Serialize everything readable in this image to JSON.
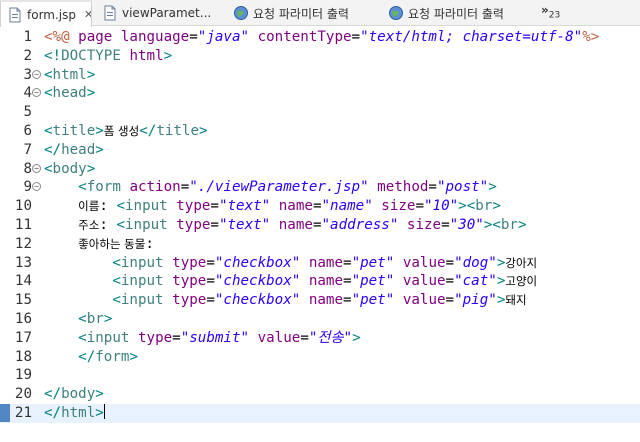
{
  "tabs": [
    {
      "label": "form.jsp",
      "icon": "jsp-file-icon",
      "active": true,
      "close": "✕"
    },
    {
      "label": "viewParamet...",
      "icon": "jsp-file-icon",
      "active": false
    },
    {
      "label": "요청 파라미터 출력",
      "icon": "globe-icon",
      "active": false
    },
    {
      "label": "요청 파라미터 출력",
      "icon": "globe-icon",
      "active": false
    }
  ],
  "overflow": {
    "label": "»",
    "count": "23"
  },
  "editor": {
    "current_line": 21,
    "lines": [
      {
        "n": "1",
        "tokens": [
          [
            "dir",
            "<%@"
          ],
          [
            "text",
            " "
          ],
          [
            "attr",
            "page"
          ],
          [
            "text",
            " "
          ],
          [
            "attr",
            "language"
          ],
          [
            "text",
            "="
          ],
          [
            "val",
            "\"java\""
          ],
          [
            "text",
            " "
          ],
          [
            "attr",
            "contentType"
          ],
          [
            "text",
            "="
          ],
          [
            "val",
            "\"text/html; charset=utf-8\""
          ],
          [
            "dir",
            "%>"
          ]
        ]
      },
      {
        "n": "2",
        "tokens": [
          [
            "delim",
            "<!"
          ],
          [
            "tag",
            "DOCTYPE"
          ],
          [
            "text",
            " "
          ],
          [
            "attr",
            "html"
          ],
          [
            "delim",
            ">"
          ]
        ]
      },
      {
        "n": "3",
        "fold": true,
        "tokens": [
          [
            "delim",
            "<"
          ],
          [
            "tag",
            "html"
          ],
          [
            "delim",
            ">"
          ]
        ]
      },
      {
        "n": "4",
        "fold": true,
        "tokens": [
          [
            "delim",
            "<"
          ],
          [
            "tag",
            "head"
          ],
          [
            "delim",
            ">"
          ]
        ]
      },
      {
        "n": "5",
        "tokens": []
      },
      {
        "n": "6",
        "tokens": [
          [
            "delim",
            "<"
          ],
          [
            "tag",
            "title"
          ],
          [
            "delim",
            ">"
          ],
          [
            "ko",
            "폼 생성"
          ],
          [
            "delim",
            "</"
          ],
          [
            "tag",
            "title"
          ],
          [
            "delim",
            ">"
          ]
        ]
      },
      {
        "n": "7",
        "tokens": [
          [
            "delim",
            "</"
          ],
          [
            "tag",
            "head"
          ],
          [
            "delim",
            ">"
          ]
        ]
      },
      {
        "n": "8",
        "fold": true,
        "tokens": [
          [
            "delim",
            "<"
          ],
          [
            "tag",
            "body"
          ],
          [
            "delim",
            ">"
          ]
        ]
      },
      {
        "n": "9",
        "fold": true,
        "tokens": [
          [
            "text",
            "    "
          ],
          [
            "delim",
            "<"
          ],
          [
            "tag",
            "form"
          ],
          [
            "text",
            " "
          ],
          [
            "attr",
            "action"
          ],
          [
            "text",
            "="
          ],
          [
            "val",
            "\"./viewParameter.jsp\""
          ],
          [
            "text",
            " "
          ],
          [
            "attr",
            "method"
          ],
          [
            "text",
            "="
          ],
          [
            "val",
            "\"post\""
          ],
          [
            "delim",
            ">"
          ]
        ]
      },
      {
        "n": "10",
        "tokens": [
          [
            "text",
            "    "
          ],
          [
            "ko",
            "이름"
          ],
          [
            "text",
            ": "
          ],
          [
            "delim",
            "<"
          ],
          [
            "tag",
            "input"
          ],
          [
            "text",
            " "
          ],
          [
            "attr",
            "type"
          ],
          [
            "text",
            "="
          ],
          [
            "val",
            "\"text\""
          ],
          [
            "text",
            " "
          ],
          [
            "attr",
            "name"
          ],
          [
            "text",
            "="
          ],
          [
            "val",
            "\"name\""
          ],
          [
            "text",
            " "
          ],
          [
            "attr",
            "size"
          ],
          [
            "text",
            "="
          ],
          [
            "val",
            "\"10\""
          ],
          [
            "delim",
            ">"
          ],
          [
            "delim",
            "<"
          ],
          [
            "tag",
            "br"
          ],
          [
            "delim",
            ">"
          ]
        ]
      },
      {
        "n": "11",
        "tokens": [
          [
            "text",
            "    "
          ],
          [
            "ko",
            "주소"
          ],
          [
            "text",
            ": "
          ],
          [
            "delim",
            "<"
          ],
          [
            "tag",
            "input"
          ],
          [
            "text",
            " "
          ],
          [
            "attr",
            "type"
          ],
          [
            "text",
            "="
          ],
          [
            "val",
            "\"text\""
          ],
          [
            "text",
            " "
          ],
          [
            "attr",
            "name"
          ],
          [
            "text",
            "="
          ],
          [
            "val",
            "\"address\""
          ],
          [
            "text",
            " "
          ],
          [
            "attr",
            "size"
          ],
          [
            "text",
            "="
          ],
          [
            "val",
            "\"30\""
          ],
          [
            "delim",
            ">"
          ],
          [
            "delim",
            "<"
          ],
          [
            "tag",
            "br"
          ],
          [
            "delim",
            ">"
          ]
        ]
      },
      {
        "n": "12",
        "tokens": [
          [
            "text",
            "    "
          ],
          [
            "ko",
            "좋아하는 동물"
          ],
          [
            "text",
            ":"
          ]
        ]
      },
      {
        "n": "13",
        "tokens": [
          [
            "text",
            "        "
          ],
          [
            "delim",
            "<"
          ],
          [
            "tag",
            "input"
          ],
          [
            "text",
            " "
          ],
          [
            "attr",
            "type"
          ],
          [
            "text",
            "="
          ],
          [
            "val",
            "\"checkbox\""
          ],
          [
            "text",
            " "
          ],
          [
            "attr",
            "name"
          ],
          [
            "text",
            "="
          ],
          [
            "val",
            "\"pet\""
          ],
          [
            "text",
            " "
          ],
          [
            "attr",
            "value"
          ],
          [
            "text",
            "="
          ],
          [
            "val",
            "\"dog\""
          ],
          [
            "delim",
            ">"
          ],
          [
            "ko",
            "강아지"
          ]
        ]
      },
      {
        "n": "14",
        "tokens": [
          [
            "text",
            "        "
          ],
          [
            "delim",
            "<"
          ],
          [
            "tag",
            "input"
          ],
          [
            "text",
            " "
          ],
          [
            "attr",
            "type"
          ],
          [
            "text",
            "="
          ],
          [
            "val",
            "\"checkbox\""
          ],
          [
            "text",
            " "
          ],
          [
            "attr",
            "name"
          ],
          [
            "text",
            "="
          ],
          [
            "val",
            "\"pet\""
          ],
          [
            "text",
            " "
          ],
          [
            "attr",
            "value"
          ],
          [
            "text",
            "="
          ],
          [
            "val",
            "\"cat\""
          ],
          [
            "delim",
            ">"
          ],
          [
            "ko",
            "고양이"
          ]
        ]
      },
      {
        "n": "15",
        "tokens": [
          [
            "text",
            "        "
          ],
          [
            "delim",
            "<"
          ],
          [
            "tag",
            "input"
          ],
          [
            "text",
            " "
          ],
          [
            "attr",
            "type"
          ],
          [
            "text",
            "="
          ],
          [
            "val",
            "\"checkbox\""
          ],
          [
            "text",
            " "
          ],
          [
            "attr",
            "name"
          ],
          [
            "text",
            "="
          ],
          [
            "val",
            "\"pet\""
          ],
          [
            "text",
            " "
          ],
          [
            "attr",
            "value"
          ],
          [
            "text",
            "="
          ],
          [
            "val",
            "\"pig\""
          ],
          [
            "delim",
            ">"
          ],
          [
            "ko",
            "돼지"
          ]
        ]
      },
      {
        "n": "16",
        "tokens": [
          [
            "text",
            "    "
          ],
          [
            "delim",
            "<"
          ],
          [
            "tag",
            "br"
          ],
          [
            "delim",
            ">"
          ]
        ]
      },
      {
        "n": "17",
        "tokens": [
          [
            "text",
            "    "
          ],
          [
            "delim",
            "<"
          ],
          [
            "tag",
            "input"
          ],
          [
            "text",
            " "
          ],
          [
            "attr",
            "type"
          ],
          [
            "text",
            "="
          ],
          [
            "val",
            "\"submit\""
          ],
          [
            "text",
            " "
          ],
          [
            "attr",
            "value"
          ],
          [
            "text",
            "="
          ],
          [
            "val",
            "\"전송\""
          ],
          [
            "delim",
            ">"
          ]
        ]
      },
      {
        "n": "18",
        "tokens": [
          [
            "text",
            "    "
          ],
          [
            "delim",
            "</"
          ],
          [
            "tag",
            "form"
          ],
          [
            "delim",
            ">"
          ]
        ]
      },
      {
        "n": "19",
        "tokens": []
      },
      {
        "n": "20",
        "tokens": [
          [
            "delim",
            "</"
          ],
          [
            "tag",
            "body"
          ],
          [
            "delim",
            ">"
          ]
        ]
      },
      {
        "n": "21",
        "tokens": [
          [
            "delim",
            "</"
          ],
          [
            "tag",
            "html"
          ],
          [
            "delim",
            ">"
          ]
        ]
      }
    ]
  }
}
